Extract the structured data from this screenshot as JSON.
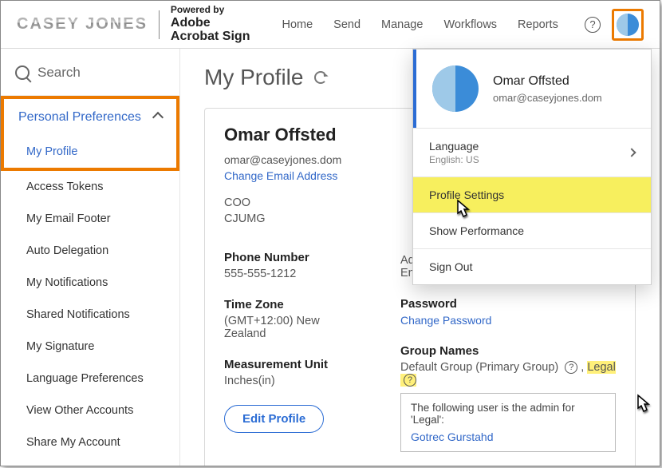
{
  "header": {
    "logo": "CASEY JONES",
    "poweredBy": "Powered by",
    "brand1": "Adobe",
    "brand2": "Acrobat Sign",
    "nav": {
      "home": "Home",
      "send": "Send",
      "manage": "Manage",
      "workflows": "Workflows",
      "reports": "Reports"
    },
    "help": "?"
  },
  "sidebar": {
    "search": "Search",
    "groupTitle": "Personal Preferences",
    "items": {
      "my_profile": "My Profile",
      "access_tokens": "Access Tokens",
      "email_footer": "My Email Footer",
      "auto_delegation": "Auto Delegation",
      "my_notifications": "My Notifications",
      "shared_notifications": "Shared Notifications",
      "my_signature": "My Signature",
      "language_prefs": "Language Preferences",
      "view_other": "View Other Accounts",
      "share_account": "Share My Account"
    }
  },
  "page": {
    "title": "My Profile"
  },
  "profile": {
    "name": "Omar Offsted",
    "email": "omar@caseyjones.dom",
    "changeEmail": "Change Email Address",
    "role": "COO",
    "company": "CJUMG",
    "phoneLabel": "Phone Number",
    "phone": "555-555-1212",
    "tzLabel": "Time Zone",
    "tz": "(GMT+12:00) New Zealand",
    "muLabel": "Measurement Unit",
    "mu": "Inches(in)",
    "editBtn": "Edit Profile",
    "product": "Adobe Acrobat Sign Solutions for Enterprise",
    "pwLabel": "Password",
    "changePw": "Change Password",
    "groupsLabel": "Group Names",
    "groupsPrimary": "Default Group (Primary Group)",
    "groupsSep": ",",
    "groupsLegal": "Legal",
    "tooltipIntro": "The following user is the admin for 'Legal':",
    "tooltipUser": "Gotrec Gurstahd"
  },
  "dropdown": {
    "name": "Omar Offsted",
    "email": "omar@caseyjones.dom",
    "languageLabel": "Language",
    "languageVal": "English: US",
    "profileSettings": "Profile Settings",
    "showPerf": "Show Performance",
    "signOut": "Sign Out"
  }
}
